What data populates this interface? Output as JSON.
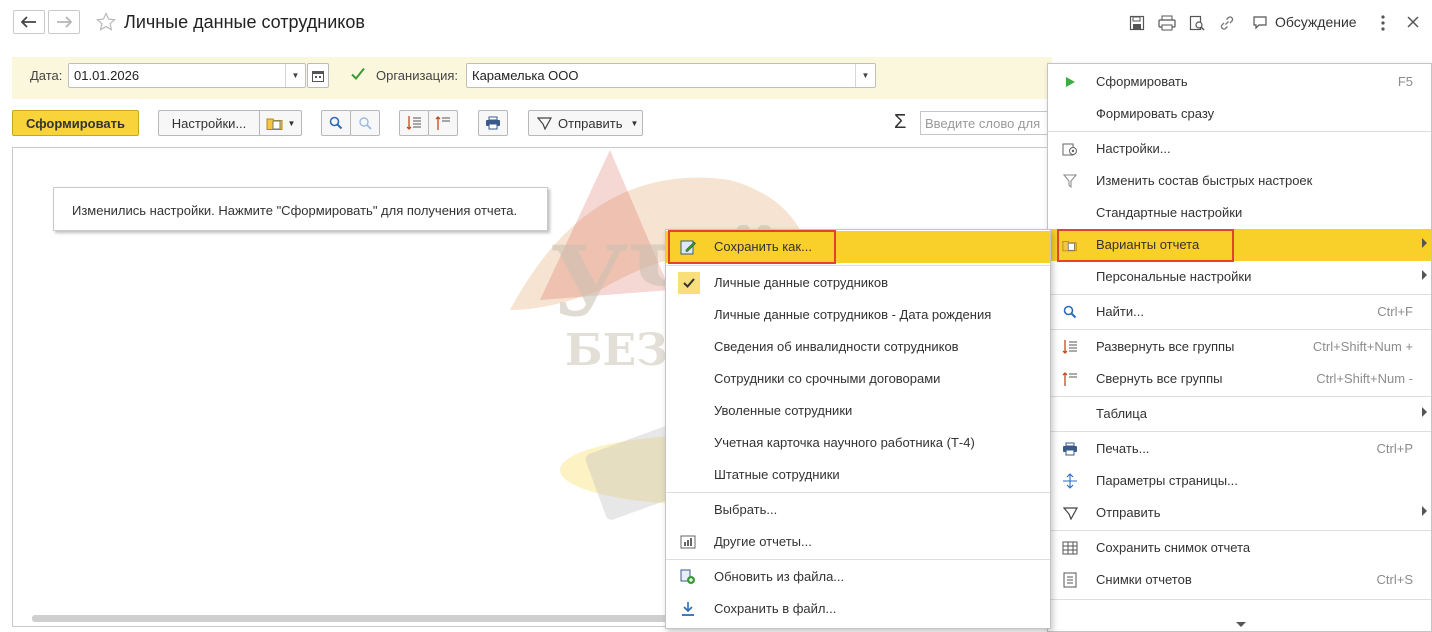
{
  "window": {
    "title": "Личные данные сотрудников",
    "discussion_label": "Обсуждение"
  },
  "params": {
    "date_label": "Дата:",
    "date_value": "01.01.2026",
    "org_label": "Организация:",
    "org_value": "Карамелька ООО",
    "org_checked": true
  },
  "toolbar": {
    "generate_label": "Сформировать",
    "settings_label": "Настройки...",
    "send_label": "Отправить",
    "sum_symbol": "Σ",
    "search_placeholder": "Введите слово для"
  },
  "notice": "Изменились настройки. Нажмите \"Сформировать\" для получения отчета.",
  "watermark": {
    "line1": "УЧЁТ",
    "line2": "БЕЗ ЗАБОТ"
  },
  "main_menu": [
    {
      "icon": "play-icon",
      "label": "Сформировать",
      "shortcut": "F5"
    },
    {
      "icon": "",
      "label": "Формировать сразу",
      "shortcut": ""
    },
    {
      "icon": "settings-icon",
      "label": "Настройки...",
      "shortcut": ""
    },
    {
      "icon": "filter-icon",
      "label": "Изменить состав быстрых настроек",
      "shortcut": ""
    },
    {
      "icon": "",
      "label": "Стандартные настройки",
      "shortcut": ""
    },
    {
      "icon": "report-variants-icon",
      "label": "Варианты отчета",
      "shortcut": "",
      "submenu": true,
      "highlighted": true
    },
    {
      "icon": "",
      "label": "Персональные настройки",
      "shortcut": "",
      "submenu": true
    },
    {
      "icon": "search-icon",
      "label": "Найти...",
      "shortcut": "Ctrl+F"
    },
    {
      "icon": "expand-groups-icon",
      "label": "Развернуть все группы",
      "shortcut": "Ctrl+Shift+Num +"
    },
    {
      "icon": "collapse-groups-icon",
      "label": "Свернуть все группы",
      "shortcut": "Ctrl+Shift+Num -"
    },
    {
      "icon": "",
      "label": "Таблица",
      "shortcut": "",
      "submenu": true
    },
    {
      "icon": "print-icon",
      "label": "Печать...",
      "shortcut": "Ctrl+P"
    },
    {
      "icon": "page-params-icon",
      "label": "Параметры страницы...",
      "shortcut": ""
    },
    {
      "icon": "send-icon",
      "label": "Отправить",
      "shortcut": "",
      "submenu": true
    },
    {
      "icon": "snapshot-save-icon",
      "label": "Сохранить снимок отчета",
      "shortcut": ""
    },
    {
      "icon": "snapshots-icon",
      "label": "Снимки отчетов",
      "shortcut": "Ctrl+S"
    }
  ],
  "sub_menu": [
    {
      "icon": "save-as-icon",
      "label": "Сохранить как...",
      "highlighted": true
    },
    {
      "icon": "check-icon",
      "label": "Личные данные сотрудников",
      "checked": true
    },
    {
      "icon": "",
      "label": "Личные данные сотрудников - Дата рождения"
    },
    {
      "icon": "",
      "label": "Сведения об инвалидности сотрудников"
    },
    {
      "icon": "",
      "label": "Сотрудники со срочными договорами"
    },
    {
      "icon": "",
      "label": "Уволенные сотрудники"
    },
    {
      "icon": "",
      "label": "Учетная карточка научного работника (Т-4)"
    },
    {
      "icon": "",
      "label": "Штатные сотрудники"
    },
    {
      "icon": "",
      "label": "Выбрать..."
    },
    {
      "icon": "other-reports-icon",
      "label": "Другие отчеты..."
    },
    {
      "icon": "update-from-file-icon",
      "label": "Обновить из файла..."
    },
    {
      "icon": "save-to-file-icon",
      "label": "Сохранить в файл..."
    }
  ],
  "colors": {
    "accent_yellow": "#f9cf2a",
    "param_band": "#fbf7dc",
    "highlight_outline": "#e0442a"
  }
}
